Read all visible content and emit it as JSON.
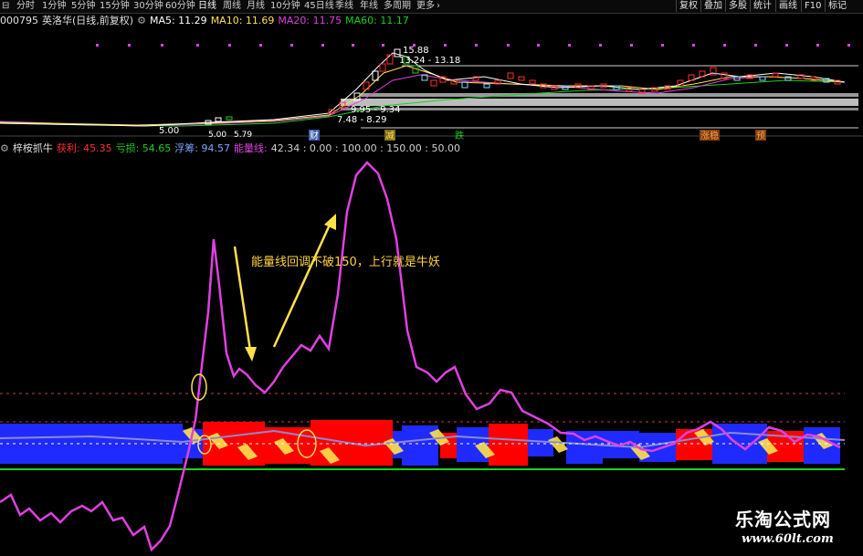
{
  "toolbar": {
    "periods": [
      "分时",
      "1分钟",
      "5分钟",
      "15分钟",
      "30分钟",
      "60分钟",
      "日线",
      "周线",
      "月线",
      "10分钟",
      "45日线",
      "季线",
      "年线",
      "多周期",
      "更多"
    ],
    "buttons": [
      "复权",
      "叠加",
      "多股",
      "统计",
      "画线",
      "F10",
      "标记"
    ]
  },
  "info": {
    "code": "000795",
    "name": "英洛华(日线,前复权)",
    "ma5": "MA5: 11.29",
    "ma10": "MA10: 11.69",
    "ma20": "MA20: 11.75",
    "ma60": "MA60: 11.17"
  },
  "price_panel": {
    "labels": {
      "high": "15.88",
      "range": "13.24 - 13.18",
      "mid": "9.95 - 9.34",
      "low_range": "7.48 - 8.29",
      "low1": "5.00",
      "low2": "5.00",
      "low3": "5.79"
    },
    "markers": [
      "财",
      "减",
      "跌",
      "涨稳",
      "预"
    ]
  },
  "indicator": {
    "name": "梓桉抓牛",
    "profit": "获利: 45.35",
    "loss": "亏损: 54.65",
    "float": "浮筹: 94.57",
    "energy_label": "能量线:",
    "energy_values": "42.34 : 0.00 : 100.00 : 150.00 : 50.00",
    "annotation": "能量线回调不破150，上行就是牛妖"
  },
  "colors": {
    "energy": "#e040e0",
    "profit_red": "#ff0000",
    "blue": "#1f2aff",
    "yellow": "#ffe24a",
    "green": "#19d219",
    "ma5": "#ffffff",
    "ma10": "#ffe24a",
    "ma20": "#e040e0",
    "ma60": "#19d219"
  },
  "watermark": {
    "title": "乐淘公式网",
    "url": "www.60lt.com"
  }
}
